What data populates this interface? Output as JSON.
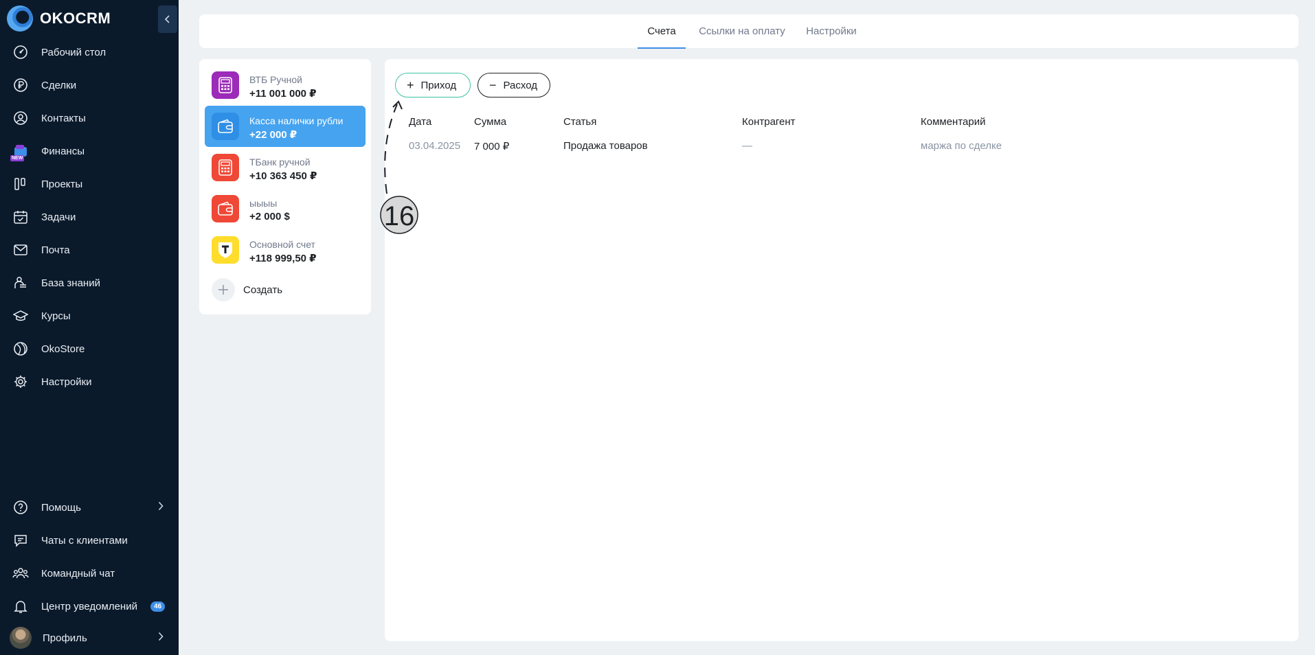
{
  "brand": {
    "name": "OKOCRM"
  },
  "sidebar": {
    "items": [
      {
        "label": "Рабочий стол",
        "icon": "dashboard-icon"
      },
      {
        "label": "Сделки",
        "icon": "ruble-icon"
      },
      {
        "label": "Контакты",
        "icon": "user-icon"
      },
      {
        "label": "Финансы",
        "icon": "finance-icon",
        "badge": "NEW"
      },
      {
        "label": "Проекты",
        "icon": "projects-icon"
      },
      {
        "label": "Задачи",
        "icon": "calendar-check-icon"
      },
      {
        "label": "Почта",
        "icon": "mail-icon"
      },
      {
        "label": "База знаний",
        "icon": "knowledge-icon"
      },
      {
        "label": "Курсы",
        "icon": "graduation-cap-icon"
      },
      {
        "label": "OkoStore",
        "icon": "store-icon"
      },
      {
        "label": "Настройки",
        "icon": "gear-icon"
      }
    ],
    "bottom": [
      {
        "label": "Помощь",
        "icon": "help-icon"
      },
      {
        "label": "Чаты с клиентами",
        "icon": "chat-icon"
      },
      {
        "label": "Командный чат",
        "icon": "team-icon"
      },
      {
        "label": "Центр уведомлений",
        "icon": "bell-icon",
        "count": "46"
      },
      {
        "label": "Профиль",
        "icon": "avatar"
      }
    ]
  },
  "tabs": [
    {
      "label": "Счета",
      "active": true
    },
    {
      "label": "Ссылки на оплату",
      "active": false
    },
    {
      "label": "Настройки",
      "active": false
    }
  ],
  "accounts": {
    "items": [
      {
        "name": "ВТБ Ручной",
        "amount": "+11 001 000 ₽",
        "icon": "calculator-icon",
        "color": "#9b2bb8"
      },
      {
        "name": "Касса налички рубли",
        "amount": "+22 000 ₽",
        "icon": "wallet-icon",
        "color": "#2f8fe6",
        "selected": true
      },
      {
        "name": "ТБанк ручной",
        "amount": "+10 363 450 ₽",
        "icon": "calculator-icon",
        "color": "#ef4836"
      },
      {
        "name": "ыыыы",
        "amount": "+2 000 $",
        "icon": "wallet-icon",
        "color": "#ef4836"
      },
      {
        "name": "Основной счет",
        "amount": "+118 999,50 ₽",
        "icon": "tbank-logo-icon",
        "color": "#ffdd2d"
      }
    ],
    "create_label": "Создать"
  },
  "actions": {
    "income": "Приход",
    "expense": "Расход"
  },
  "table": {
    "headers": [
      "Дата",
      "Сумма",
      "Статья",
      "Контрагент",
      "Комментарий"
    ],
    "rows": [
      {
        "date": "03.04.2025",
        "amount": "7 000 ₽",
        "article": "Продажа товаров",
        "counterparty": "—",
        "comment": "маржа по сделке"
      }
    ]
  },
  "annotation": {
    "step": "16"
  }
}
